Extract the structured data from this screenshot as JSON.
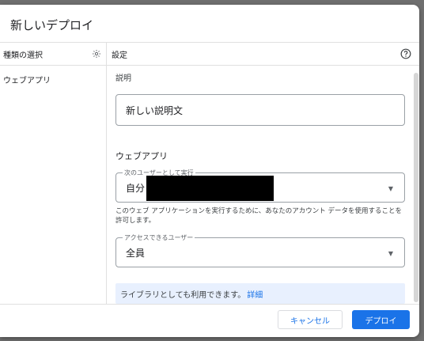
{
  "dialog": {
    "title": "新しいデプロイ",
    "left": {
      "header": "種類の選択",
      "items": [
        "ウェブアプリ"
      ]
    },
    "right": {
      "header": "設定",
      "description_label": "説明",
      "description_value": "新しい説明文",
      "webapp_section": "ウェブアプリ",
      "execute_as": {
        "legend": "次のユーザーとして実行",
        "value": "自分"
      },
      "authorize_note": "このウェブ アプリケーションを実行するために、あなたのアカウント データを使用することを許可します。",
      "access": {
        "legend": "アクセスできるユーザー",
        "value": "全員"
      },
      "library_info": "ライブラリとしても利用できます。",
      "library_link": "詳細"
    },
    "buttons": {
      "cancel": "キャンセル",
      "deploy": "デプロイ"
    }
  }
}
